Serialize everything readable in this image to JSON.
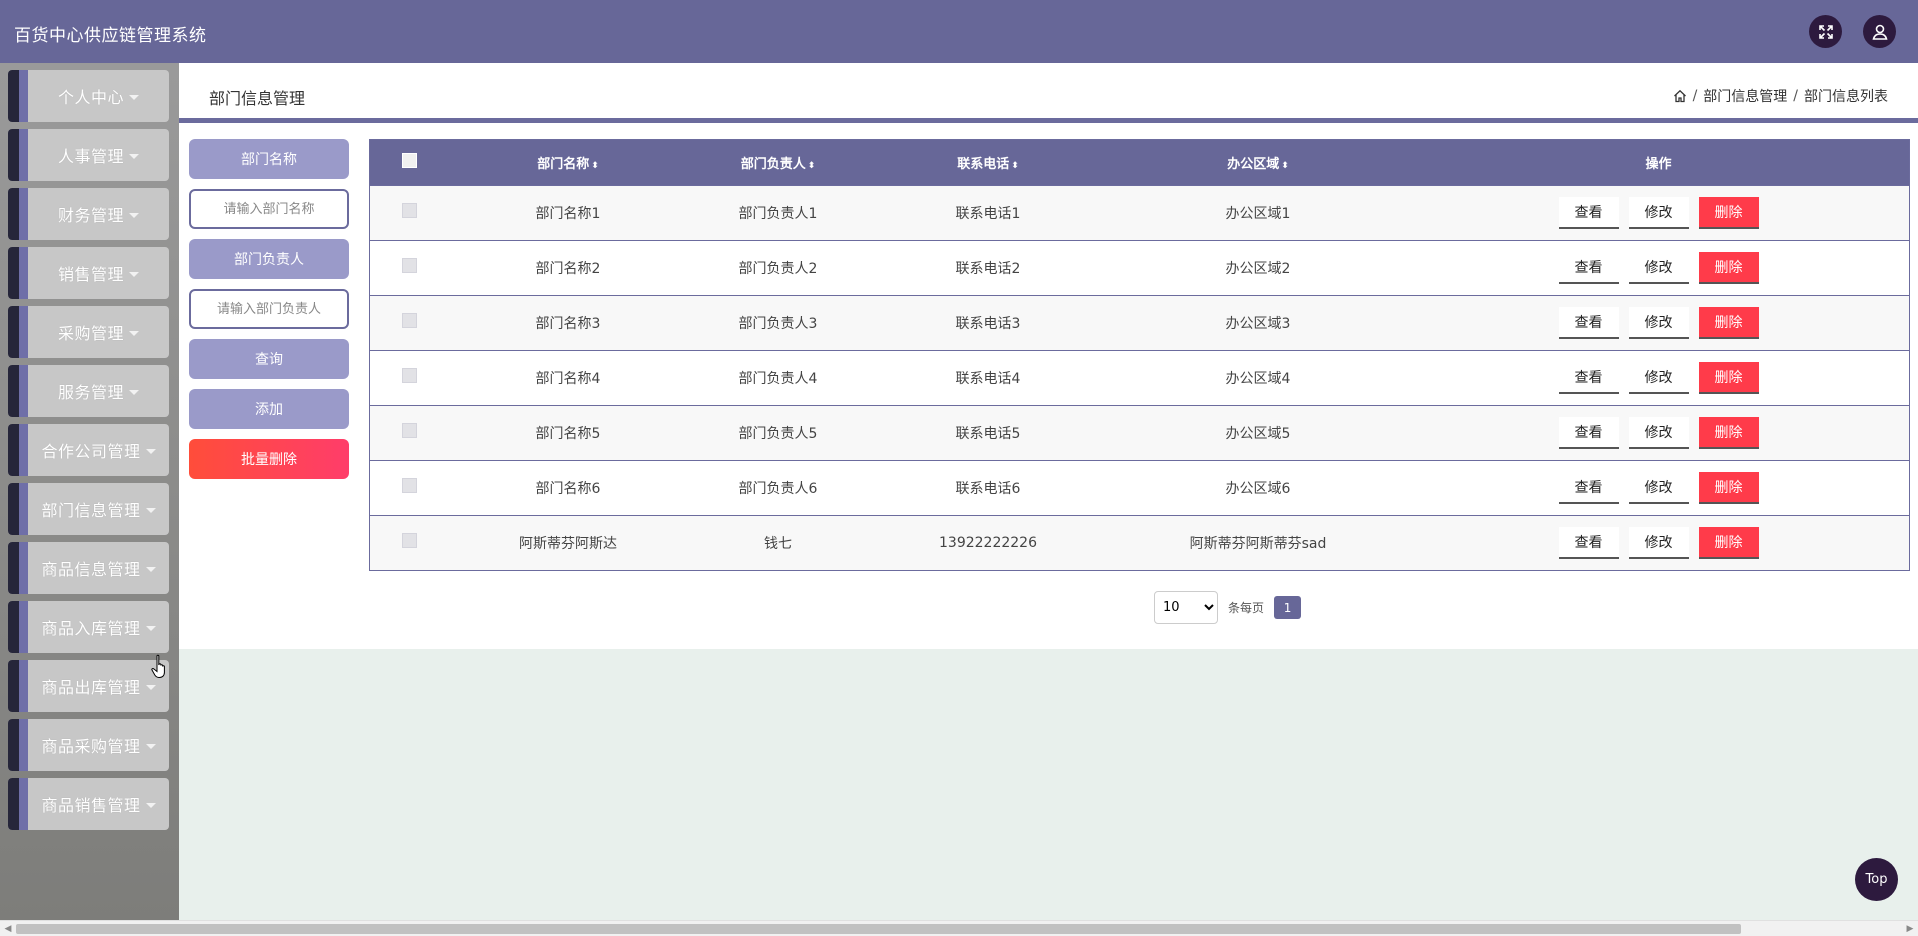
{
  "app": {
    "title": "百货中心供应链管理系统"
  },
  "header": {
    "fullscreen_icon": "expand-icon",
    "user_icon": "user-icon"
  },
  "sidebar": {
    "items": [
      {
        "label": "个人中心"
      },
      {
        "label": "人事管理"
      },
      {
        "label": "财务管理"
      },
      {
        "label": "销售管理"
      },
      {
        "label": "采购管理"
      },
      {
        "label": "服务管理"
      },
      {
        "label": "合作公司管理"
      },
      {
        "label": "部门信息管理"
      },
      {
        "label": "商品信息管理"
      },
      {
        "label": "商品入库管理"
      },
      {
        "label": "商品出库管理"
      },
      {
        "label": "商品采购管理"
      },
      {
        "label": "商品销售管理"
      }
    ]
  },
  "page": {
    "title": "部门信息管理",
    "breadcrumb": {
      "home_icon": "home-icon",
      "level1": "部门信息管理",
      "level2": "部门信息列表",
      "sep": "/"
    }
  },
  "search": {
    "name_label": "部门名称",
    "name_placeholder": "请输入部门名称",
    "manager_label": "部门负责人",
    "manager_placeholder": "请输入部门负责人",
    "query_button": "查询",
    "add_button": "添加",
    "batch_delete_button": "批量删除"
  },
  "table": {
    "columns": [
      "部门名称",
      "部门负责人",
      "联系电话",
      "办公区域",
      "操作"
    ],
    "sort_glyph": "⬍",
    "actions": {
      "view": "查看",
      "edit": "修改",
      "delete": "删除"
    },
    "rows": [
      [
        "部门名称1",
        "部门负责人1",
        "联系电话1",
        "办公区域1"
      ],
      [
        "部门名称2",
        "部门负责人2",
        "联系电话2",
        "办公区域2"
      ],
      [
        "部门名称3",
        "部门负责人3",
        "联系电话3",
        "办公区域3"
      ],
      [
        "部门名称4",
        "部门负责人4",
        "联系电话4",
        "办公区域4"
      ],
      [
        "部门名称5",
        "部门负责人5",
        "联系电话5",
        "办公区域5"
      ],
      [
        "部门名称6",
        "部门负责人6",
        "联系电话6",
        "办公区域6"
      ],
      [
        "阿斯蒂芬阿斯达",
        "钱七",
        "13922222226",
        "阿斯蒂芬阿斯蒂芬sad"
      ]
    ]
  },
  "pagination": {
    "page_size": "10",
    "per_page_label": "条每页",
    "current_page": "1"
  },
  "top_button": "Top",
  "colors": {
    "primary": "#676798",
    "accent_light": "#9a9ac9",
    "danger": "#ff3b4a",
    "dark": "#2d1a3e"
  }
}
